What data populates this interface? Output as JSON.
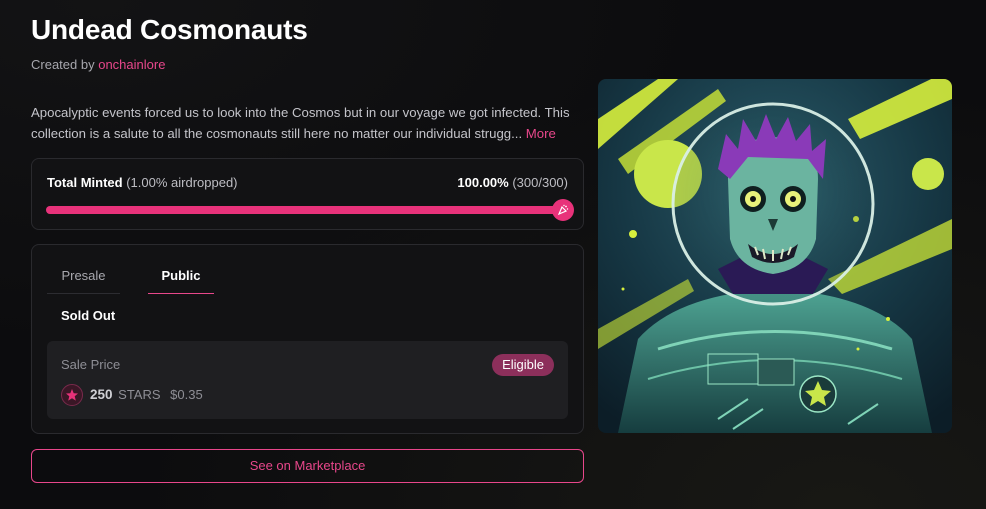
{
  "header": {
    "title": "Undead Cosmonauts",
    "created_by_prefix": "Created by",
    "creator": "onchainlore"
  },
  "description": {
    "text": "Apocalyptic events forced us to look into the Cosmos but in our voyage we got infected. This collection is a salute to all the cosmonauts still here no matter our individual strugg...",
    "more_label": "More"
  },
  "minted": {
    "label": "Total Minted",
    "airdrop_note": "(1.00% airdropped)",
    "percent": "100.00%",
    "count": "(300/300)",
    "progress_fraction": 1.0,
    "knob_icon": "confetti-icon"
  },
  "phases": {
    "tabs": [
      {
        "label": "Presale",
        "active": false
      },
      {
        "label": "Public",
        "active": true
      }
    ],
    "status": "Sold Out",
    "price": {
      "label": "Sale Price",
      "badge": "Eligible",
      "amount": "250",
      "unit": "STARS",
      "usd": "$0.35",
      "icon": "stars-token-icon"
    }
  },
  "marketplace_button": "See on Marketplace",
  "colors": {
    "accent": "#e8327a",
    "accent_text": "#e8478b",
    "badge_bg": "#8c2f5b",
    "background": "#0c0c0e",
    "card_bg": "#121214"
  },
  "artwork": {
    "subject": "zombie-cosmonaut-image"
  }
}
